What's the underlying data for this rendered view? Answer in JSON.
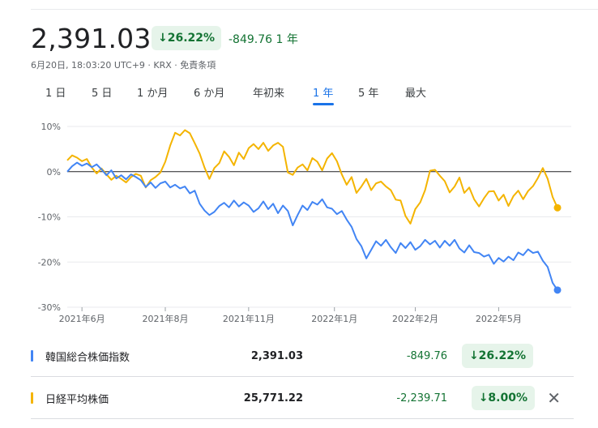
{
  "header": {
    "price": "2,391.03",
    "change_pct": "↓26.22%",
    "change_abs": "-849.76 1 年",
    "meta": "6月20日, 18:03:20 UTC+9 · KRX · 免責条項"
  },
  "tabs": [
    {
      "label": "1 日",
      "active": false
    },
    {
      "label": "5 日",
      "active": false
    },
    {
      "label": "1 か月",
      "active": false
    },
    {
      "label": "6 か月",
      "active": false
    },
    {
      "label": "年初来",
      "active": false
    },
    {
      "label": "1 年",
      "active": true
    },
    {
      "label": "5 年",
      "active": false
    },
    {
      "label": "最大",
      "active": false
    }
  ],
  "chart_data": {
    "type": "line",
    "ylim": [
      -30,
      10
    ],
    "yticks": [
      10,
      0,
      -10,
      -20,
      -30
    ],
    "ytick_labels": [
      "10%",
      "0%",
      "-10%",
      "-20%",
      "-30%"
    ],
    "baseline": 0,
    "x_range": [
      0,
      100
    ],
    "xticks": [
      {
        "x": 3,
        "label": "2021年6月"
      },
      {
        "x": 20,
        "label": "2021年8月"
      },
      {
        "x": 37,
        "label": "2021年11月"
      },
      {
        "x": 54.5,
        "label": "2022年1月"
      },
      {
        "x": 71,
        "label": "2022年2月"
      },
      {
        "x": 88,
        "label": "2022年5月"
      }
    ],
    "series": [
      {
        "name": "韓国総合株価指数",
        "color": "#4285f4",
        "points": [
          [
            0,
            0
          ],
          [
            1,
            1.2
          ],
          [
            2,
            2
          ],
          [
            3,
            1.3
          ],
          [
            4,
            1.8
          ],
          [
            5,
            1
          ],
          [
            6,
            1.6
          ],
          [
            7,
            0.5
          ],
          [
            8,
            -0.8
          ],
          [
            9,
            0.3
          ],
          [
            10,
            -1.5
          ],
          [
            11,
            -0.8
          ],
          [
            12,
            -1.7
          ],
          [
            13,
            -0.6
          ],
          [
            14,
            -1.2
          ],
          [
            15,
            -1.9
          ],
          [
            16,
            -3.4
          ],
          [
            17,
            -2.4
          ],
          [
            18,
            -3.6
          ],
          [
            19,
            -2.6
          ],
          [
            20,
            -2.2
          ],
          [
            21,
            -3.5
          ],
          [
            22,
            -2.9
          ],
          [
            23,
            -3.7
          ],
          [
            24,
            -3.3
          ],
          [
            25,
            -4.8
          ],
          [
            26,
            -4.2
          ],
          [
            27,
            -7.1
          ],
          [
            28,
            -8.6
          ],
          [
            29,
            -9.6
          ],
          [
            30,
            -8.9
          ],
          [
            31,
            -7.6
          ],
          [
            32,
            -6.9
          ],
          [
            33,
            -7.9
          ],
          [
            34,
            -6.4
          ],
          [
            35,
            -7.7
          ],
          [
            36,
            -6.8
          ],
          [
            37,
            -7.5
          ],
          [
            38,
            -8.9
          ],
          [
            39,
            -8.1
          ],
          [
            40,
            -6.6
          ],
          [
            41,
            -8.3
          ],
          [
            42,
            -7.1
          ],
          [
            43,
            -9.2
          ],
          [
            44,
            -7.5
          ],
          [
            45,
            -8.7
          ],
          [
            46,
            -11.9
          ],
          [
            47,
            -9.6
          ],
          [
            48,
            -7.5
          ],
          [
            49,
            -8.5
          ],
          [
            50,
            -6.7
          ],
          [
            51,
            -7.3
          ],
          [
            52,
            -6.1
          ],
          [
            53,
            -7.9
          ],
          [
            54,
            -8.2
          ],
          [
            55,
            -9.4
          ],
          [
            56,
            -8.7
          ],
          [
            57,
            -10.6
          ],
          [
            58,
            -12.2
          ],
          [
            59,
            -14.9
          ],
          [
            60,
            -16.5
          ],
          [
            61,
            -19.2
          ],
          [
            62,
            -17.3
          ],
          [
            63,
            -15.4
          ],
          [
            64,
            -16.4
          ],
          [
            65,
            -15.1
          ],
          [
            66,
            -16.7
          ],
          [
            67,
            -18
          ],
          [
            68,
            -15.8
          ],
          [
            69,
            -16.9
          ],
          [
            70,
            -15.6
          ],
          [
            71,
            -17.3
          ],
          [
            72,
            -16.5
          ],
          [
            73,
            -15.1
          ],
          [
            74,
            -16.1
          ],
          [
            75,
            -15.3
          ],
          [
            76,
            -16.8
          ],
          [
            77,
            -15.3
          ],
          [
            78,
            -16.4
          ],
          [
            79,
            -15.1
          ],
          [
            80,
            -17
          ],
          [
            81,
            -17.9
          ],
          [
            82,
            -16.3
          ],
          [
            83,
            -17.8
          ],
          [
            84,
            -18
          ],
          [
            85,
            -18.8
          ],
          [
            86,
            -18.4
          ],
          [
            87,
            -20.4
          ],
          [
            88,
            -19.1
          ],
          [
            89,
            -19.9
          ],
          [
            90,
            -18.8
          ],
          [
            91,
            -19.6
          ],
          [
            92,
            -17.9
          ],
          [
            93,
            -18.5
          ],
          [
            94,
            -17.2
          ],
          [
            95,
            -18
          ],
          [
            96,
            -17.7
          ],
          [
            97,
            -19.7
          ],
          [
            98,
            -21.1
          ],
          [
            99,
            -24.6
          ],
          [
            100,
            -26.2
          ]
        ]
      },
      {
        "name": "日経平均株価",
        "color": "#f4b400",
        "points": [
          [
            0,
            2.5
          ],
          [
            1,
            3.6
          ],
          [
            2,
            3.1
          ],
          [
            3,
            2.3
          ],
          [
            4,
            2.8
          ],
          [
            5,
            0.9
          ],
          [
            6,
            -0.4
          ],
          [
            7,
            0.7
          ],
          [
            8,
            -0.6
          ],
          [
            9,
            -1.8
          ],
          [
            10,
            -0.9
          ],
          [
            11,
            -1.6
          ],
          [
            12,
            -2.4
          ],
          [
            13,
            -1.2
          ],
          [
            14,
            -0.5
          ],
          [
            15,
            -0.9
          ],
          [
            16,
            -3.5
          ],
          [
            17,
            -1.9
          ],
          [
            18,
            -1.2
          ],
          [
            19,
            -0.2
          ],
          [
            20,
            2.2
          ],
          [
            21,
            5.8
          ],
          [
            22,
            8.6
          ],
          [
            23,
            8
          ],
          [
            24,
            9.2
          ],
          [
            25,
            8.5
          ],
          [
            26,
            6.3
          ],
          [
            27,
            4
          ],
          [
            28,
            0.9
          ],
          [
            29,
            -1.6
          ],
          [
            30,
            0.8
          ],
          [
            31,
            1.9
          ],
          [
            32,
            4.5
          ],
          [
            33,
            3.3
          ],
          [
            34,
            1.4
          ],
          [
            35,
            4.2
          ],
          [
            36,
            2.8
          ],
          [
            37,
            5.2
          ],
          [
            38,
            6.1
          ],
          [
            39,
            5
          ],
          [
            40,
            6.4
          ],
          [
            41,
            4.6
          ],
          [
            42,
            5.8
          ],
          [
            43,
            6.4
          ],
          [
            44,
            5.5
          ],
          [
            45,
            -0.2
          ],
          [
            46,
            -0.7
          ],
          [
            47,
            0.9
          ],
          [
            48,
            1.6
          ],
          [
            49,
            0.3
          ],
          [
            50,
            3
          ],
          [
            51,
            2.2
          ],
          [
            52,
            0.3
          ],
          [
            53,
            2.9
          ],
          [
            54,
            4.1
          ],
          [
            55,
            2.3
          ],
          [
            56,
            -0.6
          ],
          [
            57,
            -2.9
          ],
          [
            58,
            -1.2
          ],
          [
            59,
            -4.7
          ],
          [
            60,
            -3.3
          ],
          [
            61,
            -1.6
          ],
          [
            62,
            -4.1
          ],
          [
            63,
            -2.6
          ],
          [
            64,
            -2.2
          ],
          [
            65,
            -3.3
          ],
          [
            66,
            -4.1
          ],
          [
            67,
            -6.2
          ],
          [
            68,
            -6.4
          ],
          [
            69,
            -9.8
          ],
          [
            70,
            -11.5
          ],
          [
            71,
            -8.3
          ],
          [
            72,
            -6.8
          ],
          [
            73,
            -4.1
          ],
          [
            74,
            0.2
          ],
          [
            75,
            0.4
          ],
          [
            76,
            -0.9
          ],
          [
            77,
            -2.1
          ],
          [
            78,
            -4.6
          ],
          [
            79,
            -3.3
          ],
          [
            80,
            -1.3
          ],
          [
            81,
            -4.7
          ],
          [
            82,
            -3.5
          ],
          [
            83,
            -6.1
          ],
          [
            84,
            -7.7
          ],
          [
            85,
            -5.9
          ],
          [
            86,
            -4.4
          ],
          [
            87,
            -4.3
          ],
          [
            88,
            -6.4
          ],
          [
            89,
            -5.1
          ],
          [
            90,
            -7.6
          ],
          [
            91,
            -5.4
          ],
          [
            92,
            -4.2
          ],
          [
            93,
            -6.1
          ],
          [
            94,
            -4.3
          ],
          [
            95,
            -3.2
          ],
          [
            96,
            -1.4
          ],
          [
            97,
            0.8
          ],
          [
            98,
            -1.6
          ],
          [
            99,
            -5.6
          ],
          [
            100,
            -8.0
          ]
        ]
      }
    ]
  },
  "legend": [
    {
      "name": "韓国総合株価指数",
      "value": "2,391.03",
      "change_abs": "-849.76",
      "change_pct": "↓26.22%",
      "color": "#4285f4"
    },
    {
      "name": "日経平均株価",
      "value": "25,771.22",
      "change_abs": "-2,239.71",
      "change_pct": "↓8.00%",
      "color": "#f4b400"
    }
  ],
  "controls": {
    "remove_icon": "close-icon",
    "remove_glyph": "✕"
  },
  "colors": {
    "positive": "#137333",
    "positive_bg": "#e6f4ea",
    "accent": "#1a73e8"
  }
}
